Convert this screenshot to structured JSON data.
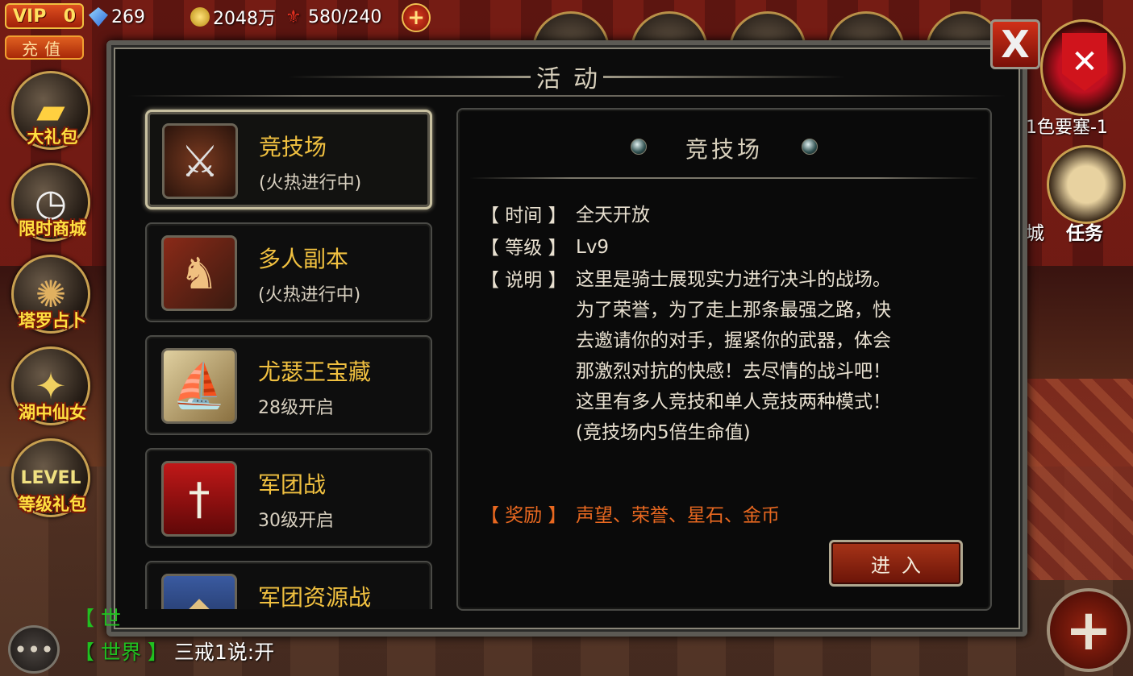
{
  "topbar": {
    "vip_label": "VIP",
    "vip_level": "0",
    "recharge_label": "充值",
    "diamonds": "269",
    "gold": "2048万",
    "stamina": "580/240"
  },
  "side_menu": [
    {
      "label": "大礼包",
      "icon": "gold-ingot-icon"
    },
    {
      "label": "限时商城",
      "icon": "clock-icon"
    },
    {
      "label": "塔罗占卜",
      "icon": "tarot-icon"
    },
    {
      "label": "湖中仙女",
      "icon": "fairy-icon"
    },
    {
      "label": "等级礼包",
      "icon": "level-icon"
    }
  ],
  "right_side": {
    "fortress_label": "1色要塞-1",
    "partial_label": "城",
    "quest_label": "任务"
  },
  "dialog": {
    "title": "活动",
    "close_label": "X"
  },
  "activities": [
    {
      "name": "竞技场",
      "status": "(火热进行中)",
      "icon": "crossed-swords-icon",
      "selected": true
    },
    {
      "name": "多人副本",
      "status": "(火热进行中)",
      "icon": "warriors-icon",
      "selected": false
    },
    {
      "name": "尤瑟王宝藏",
      "status": "28级开启",
      "icon": "ship-map-icon",
      "selected": false
    },
    {
      "name": "军团战",
      "status": "30级开启",
      "icon": "legion-crest-icon",
      "selected": false
    },
    {
      "name": "军团资源战",
      "status": "",
      "icon": "winged-shield-icon",
      "selected": false
    }
  ],
  "detail": {
    "title": "竞技场",
    "time_key": "【 时间 】",
    "time_val": "全天开放",
    "level_key": "【 等级 】",
    "level_val": "Lv9",
    "desc_key": "【 说明 】",
    "desc_lines": [
      "这里是骑士展现实力进行决斗的战场。",
      "为了荣誉，为了走上那条最强之路，快",
      "去邀请你的对手，握紧你的武器，体会",
      "那激烈对抗的快感！去尽情的战斗吧！",
      "这里有多人竞技和单人竞技两种模式！",
      "(竞技场内5倍生命值)"
    ],
    "reward_key": "【 奖励 】",
    "reward_val": "声望、荣誉、星石、金币",
    "enter_label": "进入"
  },
  "chat": {
    "partial_channel": "【 世",
    "channel": "【 世界 】",
    "message": "三戒1说:开"
  },
  "colors": {
    "gold_text": "#f0c040",
    "reward_text": "#e86820",
    "channel_text": "#20c020"
  }
}
